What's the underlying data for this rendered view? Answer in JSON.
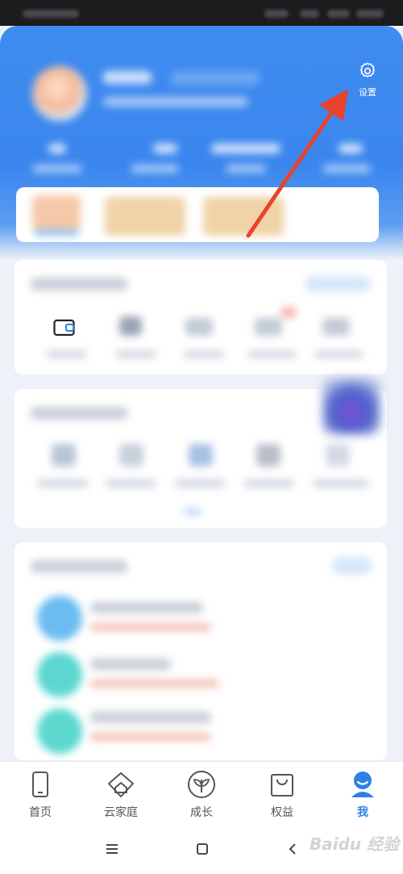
{
  "header": {
    "settings_label": "设置"
  },
  "tabs": [
    {
      "label": "首页",
      "icon": "phone-icon"
    },
    {
      "label": "云家庭",
      "icon": "home-heart-icon"
    },
    {
      "label": "成长",
      "icon": "sprout-icon"
    },
    {
      "label": "权益",
      "icon": "bag-icon"
    },
    {
      "label": "我",
      "icon": "person-icon",
      "active": true
    }
  ],
  "watermark": "Baidu 经验",
  "colors": {
    "accent": "#3a86ee",
    "arrow": "#e8432d",
    "active_tab": "#2f7fe8"
  }
}
